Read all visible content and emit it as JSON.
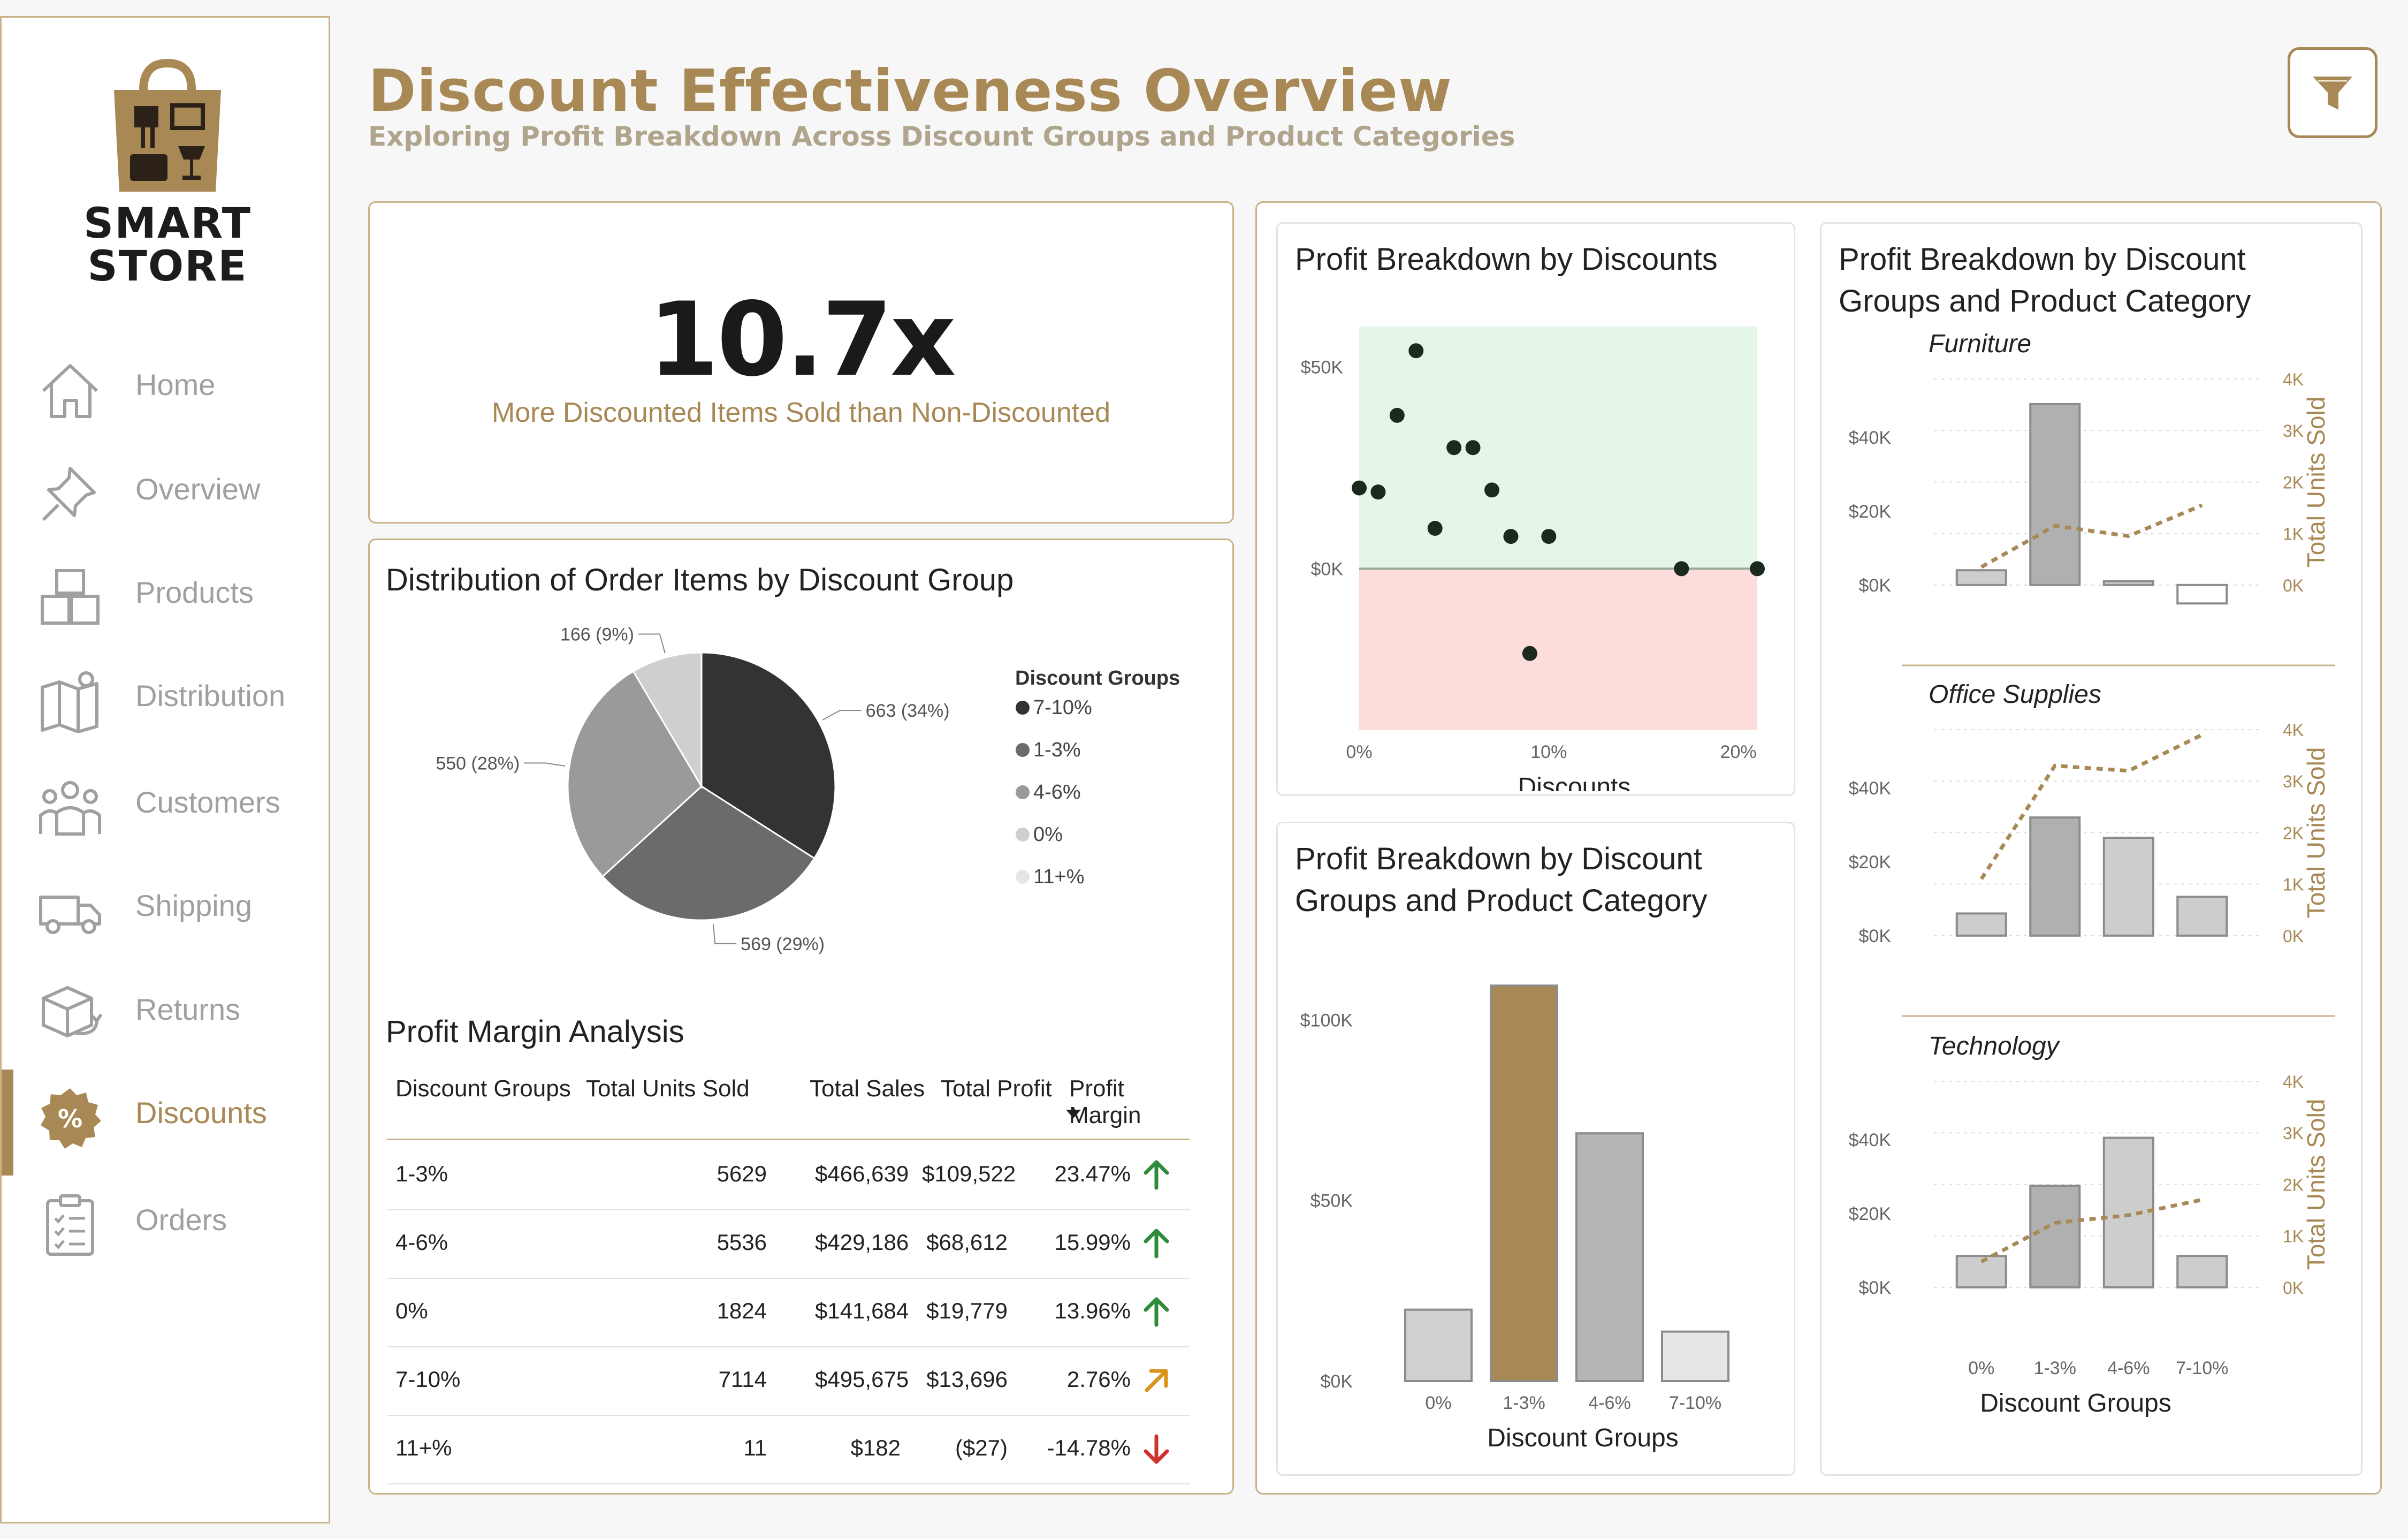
{
  "app": {
    "brand_line1": "SMART",
    "brand_line2": "STORE",
    "accent_color": "#a88955"
  },
  "sidebar": {
    "items": [
      {
        "label": "Home",
        "icon": "home-icon",
        "active": false
      },
      {
        "label": "Overview",
        "icon": "pin-icon",
        "active": false
      },
      {
        "label": "Products",
        "icon": "boxes-icon",
        "active": false
      },
      {
        "label": "Distribution",
        "icon": "map-icon",
        "active": false
      },
      {
        "label": "Customers",
        "icon": "customers-icon",
        "active": false
      },
      {
        "label": "Shipping",
        "icon": "truck-icon",
        "active": false
      },
      {
        "label": "Returns",
        "icon": "returns-icon",
        "active": false
      },
      {
        "label": "Discounts",
        "icon": "discount-badge-icon",
        "active": true
      },
      {
        "label": "Orders",
        "icon": "clipboard-icon",
        "active": false
      }
    ]
  },
  "header": {
    "title": "Discount Effectiveness Overview",
    "subtitle": "Exploring Profit Breakdown Across Discount Groups and Product Categories",
    "filter_icon": "filter-icon"
  },
  "kpi": {
    "value": "10.7x",
    "label": "More Discounted Items Sold than Non-Discounted"
  },
  "pie_card": {
    "title": "Distribution of Order Items by Discount Group",
    "legend_title": "Discount Groups"
  },
  "table": {
    "title": "Profit Margin Analysis",
    "columns": [
      "Discount Groups",
      "Total Units Sold",
      "Total Sales",
      "Total Profit",
      "Profit Margin"
    ],
    "rows": [
      {
        "group": "1-3%",
        "units": "5629",
        "sales": "$466,639",
        "profit": "$109,522",
        "margin": "23.47%",
        "trend": "up",
        "trend_color": "#2e8b3a"
      },
      {
        "group": "4-6%",
        "units": "5536",
        "sales": "$429,186",
        "profit": "$68,612",
        "margin": "15.99%",
        "trend": "up",
        "trend_color": "#2e8b3a"
      },
      {
        "group": "0%",
        "units": "1824",
        "sales": "$141,684",
        "profit": "$19,779",
        "margin": "13.96%",
        "trend": "up",
        "trend_color": "#2e8b3a"
      },
      {
        "group": "7-10%",
        "units": "7114",
        "sales": "$495,675",
        "profit": "$13,696",
        "margin": "2.76%",
        "trend": "up-right",
        "trend_color": "#d9921a"
      },
      {
        "group": "11+%",
        "units": "11",
        "sales": "$182",
        "profit": "($27)",
        "margin": "-14.78%",
        "trend": "down",
        "trend_color": "#d0312d"
      }
    ]
  },
  "chart_data": [
    {
      "type": "pie",
      "title": "Distribution of Order Items by Discount Group",
      "legend_title": "Discount Groups",
      "slices": [
        {
          "name": "7-10%",
          "value": 663,
          "label": "663 (34%)",
          "color": "#333333"
        },
        {
          "name": "1-3%",
          "value": 569,
          "label": "569 (29%)",
          "color": "#6b6b6b"
        },
        {
          "name": "4-6%",
          "value": 550,
          "label": "550 (28%)",
          "color": "#9a9a9a"
        },
        {
          "name": "0%",
          "value": 166,
          "label": "166 (9%)",
          "color": "#cfcfcf"
        },
        {
          "name": "11+%",
          "value": 0,
          "label": "",
          "color": "#e6e6e6"
        }
      ]
    },
    {
      "type": "scatter",
      "title": "Profit Breakdown by Discounts",
      "xlabel": "Discounts",
      "ylabel": "",
      "xlim": [
        0,
        0.21
      ],
      "ylim": [
        -40000,
        60000
      ],
      "x_ticks": [
        "0%",
        "10%",
        "20%"
      ],
      "y_ticks": [
        "$50K",
        "$0K"
      ],
      "positive_zone_color": "#e6f6e6",
      "negative_zone_color": "#fddcdc",
      "points": [
        {
          "x": 0.0,
          "y": 20000
        },
        {
          "x": 0.01,
          "y": 19000
        },
        {
          "x": 0.02,
          "y": 38000
        },
        {
          "x": 0.03,
          "y": 54000
        },
        {
          "x": 0.04,
          "y": 10000
        },
        {
          "x": 0.05,
          "y": 30000
        },
        {
          "x": 0.06,
          "y": 30000
        },
        {
          "x": 0.07,
          "y": 19500
        },
        {
          "x": 0.08,
          "y": 8000
        },
        {
          "x": 0.09,
          "y": -21000
        },
        {
          "x": 0.1,
          "y": 8000
        },
        {
          "x": 0.17,
          "y": 0
        },
        {
          "x": 0.21,
          "y": 0
        }
      ]
    },
    {
      "type": "bar",
      "title": "Profit Breakdown by Discount Groups and Product Category",
      "xlabel": "Discount Groups",
      "ylabel": "",
      "categories": [
        "0%",
        "1-3%",
        "4-6%",
        "7-10%"
      ],
      "values": [
        19779,
        109522,
        68612,
        13696
      ],
      "ylim": [
        0,
        110000
      ],
      "y_ticks": [
        "$100K",
        "$50K",
        "$0K"
      ],
      "colors": [
        "#d0d0d0",
        "#a88955",
        "#b5b5b5",
        "#e6e6e6"
      ]
    },
    {
      "type": "bar",
      "title": "Profit Breakdown by Discount Groups and Product Category",
      "xlabel": "Discount Groups",
      "y2label": "Total Units Sold",
      "categories": [
        "0%",
        "1-3%",
        "4-6%",
        "7-10%"
      ],
      "panels": [
        {
          "name": "Furniture",
          "profit": [
            4000,
            49000,
            1000,
            -5000
          ],
          "units": [
            350,
            1150,
            950,
            1550
          ]
        },
        {
          "name": "Office Supplies",
          "profit": [
            6000,
            32000,
            26500,
            10500
          ],
          "units": [
            1100,
            3300,
            3200,
            3900
          ]
        },
        {
          "name": "Technology",
          "profit": [
            8500,
            27500,
            40500,
            8500
          ],
          "units": [
            500,
            1250,
            1400,
            1700
          ]
        }
      ],
      "ylim": [
        -8000,
        50000
      ],
      "y2lim": [
        0,
        4000
      ],
      "y_ticks": [
        "$40K",
        "$20K",
        "$0K"
      ],
      "y2_ticks": [
        "4K",
        "3K",
        "2K",
        "1K",
        "0K"
      ],
      "line_color": "#a88955"
    }
  ]
}
